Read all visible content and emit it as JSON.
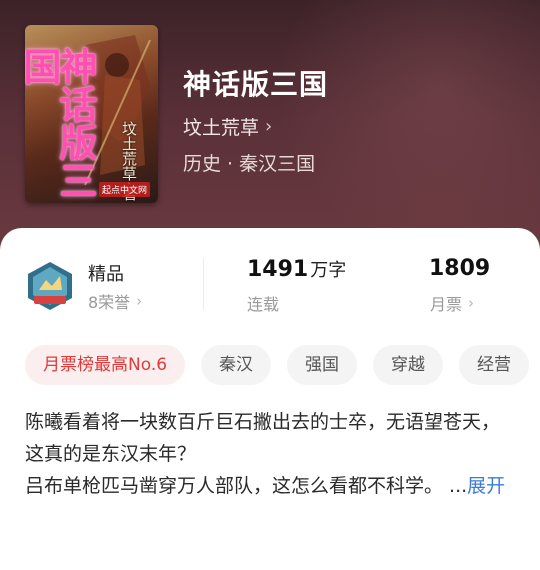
{
  "book": {
    "title": "神话版三国",
    "author": "坟土荒草",
    "genre": "历史 · 秦汉三国",
    "cover": {
      "title_text": "神话版三国",
      "author_text": "坟土荒草·著",
      "publisher_text": "起点中文网"
    }
  },
  "stats": {
    "quality": {
      "label": "精品",
      "honors": "8荣誉"
    },
    "words": {
      "number": "1491",
      "unit": "万字",
      "status": "连载"
    },
    "tickets": {
      "number": "1809",
      "label": "月票"
    }
  },
  "tags": [
    "月票榜最高No.6",
    "秦汉",
    "强国",
    "穿越",
    "经营"
  ],
  "description": {
    "line1": "陈曦看着将一块数百斤巨石撇出去的士卒，无语望苍天，这真的是东汉末年？",
    "line2": "吕布单枪匹马凿穿万人部队，这怎么看都不科学。 ...",
    "expand": "展开"
  },
  "colors": {
    "accent_red": "#e23a3a",
    "link_blue": "#3d7bd9",
    "hero_bg": "#5a3038"
  },
  "icons": {
    "chevron": "chevron-right-icon",
    "badge": "quality-badge-icon"
  }
}
